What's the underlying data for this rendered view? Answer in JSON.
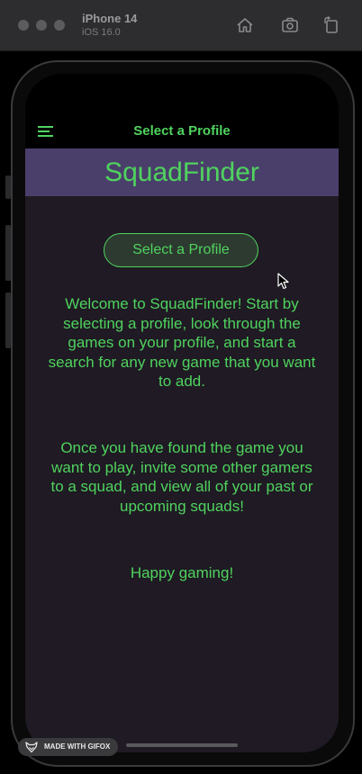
{
  "simulator": {
    "device_name": "iPhone 14",
    "os_version": "iOS 16.0",
    "icons": [
      "home-icon",
      "screenshot-icon",
      "rotate-icon"
    ]
  },
  "app": {
    "nav_title": "Select a Profile",
    "banner_title": "SquadFinder",
    "select_profile_button": "Select a Profile",
    "paragraph_1": "Welcome to SquadFinder! Start by selecting a profile, look through the games on your profile, and start a search for any new game that you want to add.",
    "paragraph_2": "Once you have found the game you want to play, invite some other gamers to a squad, and view all of your past or upcoming squads!",
    "paragraph_3": "Happy gaming!"
  },
  "watermark": {
    "text": "MADE WITH GIFOX"
  },
  "colors": {
    "accent_green": "#4fd35e",
    "banner_purple": "#4a3f6b",
    "screen_background": "#1f1a23",
    "button_background": "#2d3a30"
  }
}
